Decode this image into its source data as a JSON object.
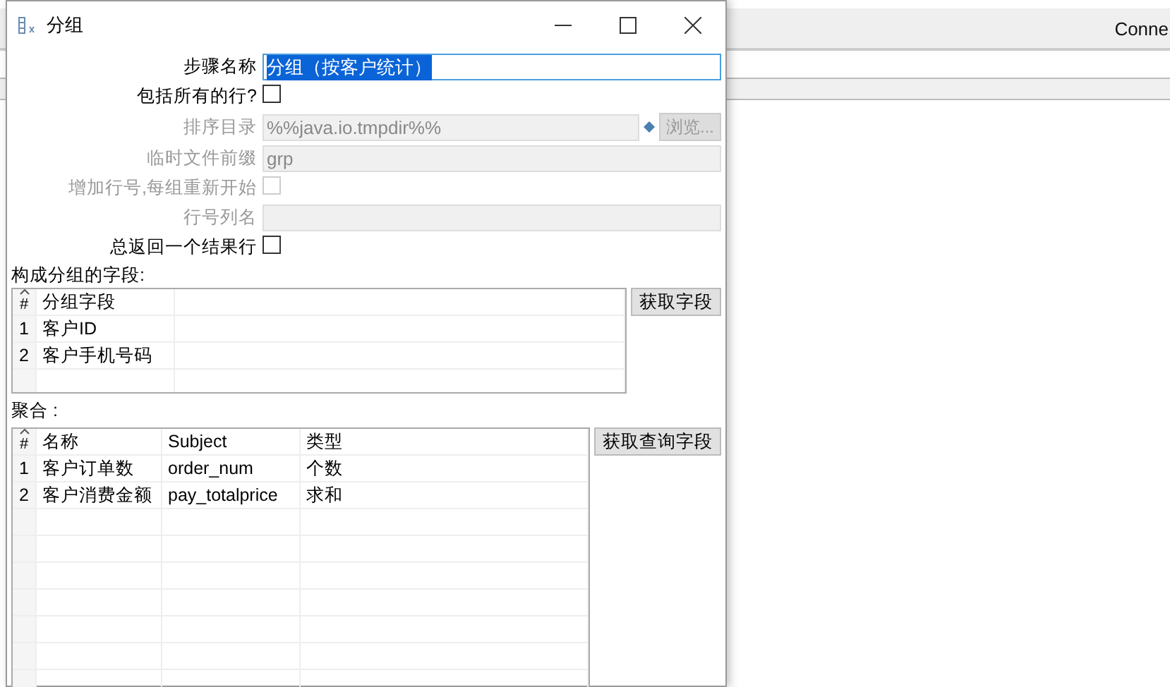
{
  "background_window": {
    "label": "Conne"
  },
  "window": {
    "title": "分组"
  },
  "form": [
    {
      "kind": "text",
      "label": "步骤名称",
      "value": "分组（按客户统计）",
      "disabled": false,
      "highlighted": true
    },
    {
      "kind": "checkbox",
      "label": "包括所有的行?",
      "checked": false,
      "disabled": false
    },
    {
      "kind": "browse",
      "label": "排序目录",
      "value": "%%java.io.tmpdir%%",
      "disabled": true,
      "button": "浏览..."
    },
    {
      "kind": "text",
      "label": "临时文件前缀",
      "value": "grp",
      "disabled": true,
      "highlighted": false
    },
    {
      "kind": "checkbox",
      "label": "增加行号,每组重新开始",
      "checked": false,
      "disabled": true
    },
    {
      "kind": "text",
      "label": "行号列名",
      "disabled": true,
      "highlighted": false
    },
    {
      "kind": "checkbox",
      "label": "总返回一个结果行",
      "checked": false,
      "disabled": false
    }
  ],
  "group_fields": {
    "label": "构成分组的字段:",
    "button": "获取字段",
    "columns": [
      "#",
      "分组字段"
    ],
    "rows": [
      [
        "1",
        "客户ID"
      ],
      [
        "2",
        "客户手机号码"
      ]
    ]
  },
  "aggregates": {
    "label": "聚合 :",
    "button": "获取查询字段",
    "columns": [
      "#",
      "名称",
      "Subject",
      "类型"
    ],
    "rows": [
      [
        "1",
        "客户订单数",
        "order_num",
        "个数"
      ],
      [
        "2",
        "客户消费金额",
        "pay_totalprice",
        "求和"
      ]
    ]
  }
}
